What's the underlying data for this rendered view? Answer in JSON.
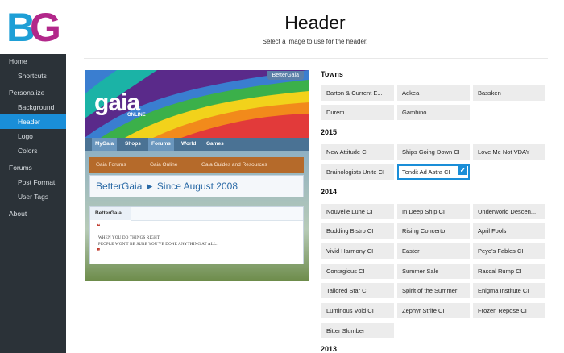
{
  "app": {
    "logo_text": "BG"
  },
  "sidebar": {
    "items": [
      {
        "label": "Home"
      },
      {
        "label": "Shortcuts"
      },
      {
        "label": "Personalize"
      },
      {
        "label": "Background"
      },
      {
        "label": "Header"
      },
      {
        "label": "Logo"
      },
      {
        "label": "Colors"
      },
      {
        "label": "Forums"
      },
      {
        "label": "Post Format"
      },
      {
        "label": "User Tags"
      },
      {
        "label": "About"
      }
    ],
    "active": "Header"
  },
  "main": {
    "title": "Header",
    "subtitle": "Select a image to use for the header."
  },
  "preview": {
    "badge": "BetterGaia",
    "logo": "gaia",
    "logo_sub": "ONLINE",
    "nav_tabs": [
      "MyGaia",
      "Shops",
      "Forums",
      "World",
      "Games"
    ],
    "crumbs": [
      "Gaia Forums",
      "Gaia Online",
      "Gaia Guides and Resources"
    ],
    "title": "BetterGaia ► Since August 2008",
    "card_title": "BetterGaia",
    "quote_open": "❝",
    "quote_close": "❞",
    "quote_line1": "WHEN YOU DO THINGS RIGHT,",
    "quote_line2": "PEOPLE WON'T BE SURE YOU'VE DONE ANYTHING AT ALL."
  },
  "sections": [
    {
      "title": "Towns",
      "items": [
        "Barton & Current E...",
        "Aekea",
        "Bassken",
        "Durem",
        "Gambino"
      ]
    },
    {
      "title": "2015",
      "items": [
        "New Attitude CI",
        "Ships Going Down CI",
        "Love Me Not VDAY",
        "Brainologists Unite CI",
        "Tendit Ad Astra CI"
      ]
    },
    {
      "title": "2014",
      "items": [
        "Nouvelle Lune CI",
        "In Deep Ship CI",
        "Underworld Descen...",
        "Budding Bistro CI",
        "Rising Concerto",
        "April Fools",
        "Vivid Harmony CI",
        "Easter",
        "Peyo's Fables CI",
        "Contagious CI",
        "Summer Sale",
        "Rascal Rump CI",
        "Tailored Star CI",
        "Spirit of the Summer",
        "Enigma Institute CI",
        "Luminous Void CI",
        "Zephyr Strife CI",
        "Frozen Repose CI",
        "Bitter Slumber"
      ]
    },
    {
      "title": "2013",
      "items": []
    }
  ],
  "selected": "Tendit Ad Astra CI",
  "check_glyph": "✓",
  "colors": {
    "sidebar_bg": "#2b3238",
    "accent": "#1a8ed8",
    "option_bg": "#ececec",
    "logo_b": "#1e9fd6",
    "logo_g": "#b2278a"
  }
}
